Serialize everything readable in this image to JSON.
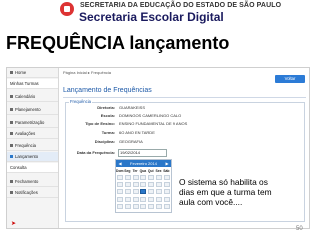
{
  "header": {
    "logo_top": "SECRETARIA DA EDUCAÇÃO DO ESTADO DE SÃO PAULO",
    "logo_bottom": "Secretaria Escolar Digital"
  },
  "slide_title": "FREQUÊNCIA lançamento",
  "sidebar": {
    "items": [
      {
        "label": "Home",
        "icon": "home-icon"
      },
      {
        "label": "Minhas Turmas",
        "icon": ""
      },
      {
        "label": "Calendário",
        "icon": "calendar-icon"
      },
      {
        "label": "Planejamento",
        "icon": "plan-icon"
      },
      {
        "label": "Parametrização",
        "icon": "settings-icon"
      },
      {
        "label": "Avaliações",
        "icon": "check-icon"
      },
      {
        "label": "Frequência",
        "icon": "frequency-icon"
      },
      {
        "label": "Lançamento",
        "icon": "arrow-right-icon"
      },
      {
        "label": "Consulta",
        "icon": ""
      },
      {
        "label": "Fechamento",
        "icon": "close-period-icon"
      },
      {
        "label": "Notificações",
        "icon": "bell-icon"
      }
    ]
  },
  "main": {
    "breadcrumb": "Página Inicial ▸ Frequência",
    "back_button": "Voltar",
    "page_heading": "Lançamento de Frequências",
    "legend": "Frequência",
    "fields": [
      {
        "label": "Diretoria:",
        "value": "GUARAKEISS"
      },
      {
        "label": "Escola:",
        "value": "DOMINGOS CAMERLINGO CALO"
      },
      {
        "label": "Tipo de Ensino:",
        "value": "ENSINO FUNDAMENTAL DE 9 ANOS"
      },
      {
        "label": "Turma:",
        "value": "6O ANO EN TARDE"
      },
      {
        "label": "Disciplina:",
        "value": "GEOGRAFIA"
      }
    ],
    "date_label": "Data da Frequência:",
    "date_value": "19/02/2014"
  },
  "calendar": {
    "month_label": "Fevereiro 2014",
    "prev": "◀",
    "next": "▶",
    "weekdays": [
      "Dom",
      "Seg",
      "Ter",
      "Qua",
      "Qui",
      "Sex",
      "Sáb"
    ],
    "selected_day": "19"
  },
  "note": "O sistema só habilita os dias em que a turma tem aula com você....",
  "page_number": "50",
  "colors": {
    "accent": "#2a77c9",
    "heading": "#1e5aa8",
    "pointer": "#cc0000"
  }
}
